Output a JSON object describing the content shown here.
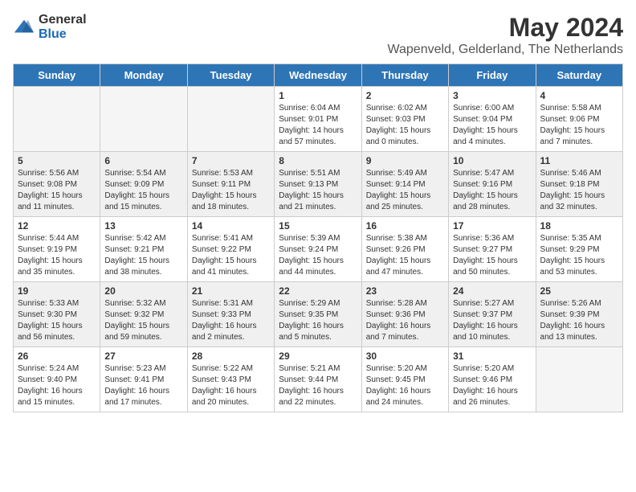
{
  "logo": {
    "general": "General",
    "blue": "Blue",
    "icon_color": "#2e75b6"
  },
  "title": "May 2024",
  "subtitle": "Wapenveld, Gelderland, The Netherlands",
  "days_of_week": [
    "Sunday",
    "Monday",
    "Tuesday",
    "Wednesday",
    "Thursday",
    "Friday",
    "Saturday"
  ],
  "weeks": [
    [
      {
        "num": "",
        "empty": true
      },
      {
        "num": "",
        "empty": true
      },
      {
        "num": "",
        "empty": true
      },
      {
        "num": "1",
        "sunrise": "Sunrise: 6:04 AM",
        "sunset": "Sunset: 9:01 PM",
        "daylight": "Daylight: 14 hours and 57 minutes."
      },
      {
        "num": "2",
        "sunrise": "Sunrise: 6:02 AM",
        "sunset": "Sunset: 9:03 PM",
        "daylight": "Daylight: 15 hours and 0 minutes."
      },
      {
        "num": "3",
        "sunrise": "Sunrise: 6:00 AM",
        "sunset": "Sunset: 9:04 PM",
        "daylight": "Daylight: 15 hours and 4 minutes."
      },
      {
        "num": "4",
        "sunrise": "Sunrise: 5:58 AM",
        "sunset": "Sunset: 9:06 PM",
        "daylight": "Daylight: 15 hours and 7 minutes."
      }
    ],
    [
      {
        "num": "5",
        "sunrise": "Sunrise: 5:56 AM",
        "sunset": "Sunset: 9:08 PM",
        "daylight": "Daylight: 15 hours and 11 minutes."
      },
      {
        "num": "6",
        "sunrise": "Sunrise: 5:54 AM",
        "sunset": "Sunset: 9:09 PM",
        "daylight": "Daylight: 15 hours and 15 minutes."
      },
      {
        "num": "7",
        "sunrise": "Sunrise: 5:53 AM",
        "sunset": "Sunset: 9:11 PM",
        "daylight": "Daylight: 15 hours and 18 minutes."
      },
      {
        "num": "8",
        "sunrise": "Sunrise: 5:51 AM",
        "sunset": "Sunset: 9:13 PM",
        "daylight": "Daylight: 15 hours and 21 minutes."
      },
      {
        "num": "9",
        "sunrise": "Sunrise: 5:49 AM",
        "sunset": "Sunset: 9:14 PM",
        "daylight": "Daylight: 15 hours and 25 minutes."
      },
      {
        "num": "10",
        "sunrise": "Sunrise: 5:47 AM",
        "sunset": "Sunset: 9:16 PM",
        "daylight": "Daylight: 15 hours and 28 minutes."
      },
      {
        "num": "11",
        "sunrise": "Sunrise: 5:46 AM",
        "sunset": "Sunset: 9:18 PM",
        "daylight": "Daylight: 15 hours and 32 minutes."
      }
    ],
    [
      {
        "num": "12",
        "sunrise": "Sunrise: 5:44 AM",
        "sunset": "Sunset: 9:19 PM",
        "daylight": "Daylight: 15 hours and 35 minutes."
      },
      {
        "num": "13",
        "sunrise": "Sunrise: 5:42 AM",
        "sunset": "Sunset: 9:21 PM",
        "daylight": "Daylight: 15 hours and 38 minutes."
      },
      {
        "num": "14",
        "sunrise": "Sunrise: 5:41 AM",
        "sunset": "Sunset: 9:22 PM",
        "daylight": "Daylight: 15 hours and 41 minutes."
      },
      {
        "num": "15",
        "sunrise": "Sunrise: 5:39 AM",
        "sunset": "Sunset: 9:24 PM",
        "daylight": "Daylight: 15 hours and 44 minutes."
      },
      {
        "num": "16",
        "sunrise": "Sunrise: 5:38 AM",
        "sunset": "Sunset: 9:26 PM",
        "daylight": "Daylight: 15 hours and 47 minutes."
      },
      {
        "num": "17",
        "sunrise": "Sunrise: 5:36 AM",
        "sunset": "Sunset: 9:27 PM",
        "daylight": "Daylight: 15 hours and 50 minutes."
      },
      {
        "num": "18",
        "sunrise": "Sunrise: 5:35 AM",
        "sunset": "Sunset: 9:29 PM",
        "daylight": "Daylight: 15 hours and 53 minutes."
      }
    ],
    [
      {
        "num": "19",
        "sunrise": "Sunrise: 5:33 AM",
        "sunset": "Sunset: 9:30 PM",
        "daylight": "Daylight: 15 hours and 56 minutes."
      },
      {
        "num": "20",
        "sunrise": "Sunrise: 5:32 AM",
        "sunset": "Sunset: 9:32 PM",
        "daylight": "Daylight: 15 hours and 59 minutes."
      },
      {
        "num": "21",
        "sunrise": "Sunrise: 5:31 AM",
        "sunset": "Sunset: 9:33 PM",
        "daylight": "Daylight: 16 hours and 2 minutes."
      },
      {
        "num": "22",
        "sunrise": "Sunrise: 5:29 AM",
        "sunset": "Sunset: 9:35 PM",
        "daylight": "Daylight: 16 hours and 5 minutes."
      },
      {
        "num": "23",
        "sunrise": "Sunrise: 5:28 AM",
        "sunset": "Sunset: 9:36 PM",
        "daylight": "Daylight: 16 hours and 7 minutes."
      },
      {
        "num": "24",
        "sunrise": "Sunrise: 5:27 AM",
        "sunset": "Sunset: 9:37 PM",
        "daylight": "Daylight: 16 hours and 10 minutes."
      },
      {
        "num": "25",
        "sunrise": "Sunrise: 5:26 AM",
        "sunset": "Sunset: 9:39 PM",
        "daylight": "Daylight: 16 hours and 13 minutes."
      }
    ],
    [
      {
        "num": "26",
        "sunrise": "Sunrise: 5:24 AM",
        "sunset": "Sunset: 9:40 PM",
        "daylight": "Daylight: 16 hours and 15 minutes."
      },
      {
        "num": "27",
        "sunrise": "Sunrise: 5:23 AM",
        "sunset": "Sunset: 9:41 PM",
        "daylight": "Daylight: 16 hours and 17 minutes."
      },
      {
        "num": "28",
        "sunrise": "Sunrise: 5:22 AM",
        "sunset": "Sunset: 9:43 PM",
        "daylight": "Daylight: 16 hours and 20 minutes."
      },
      {
        "num": "29",
        "sunrise": "Sunrise: 5:21 AM",
        "sunset": "Sunset: 9:44 PM",
        "daylight": "Daylight: 16 hours and 22 minutes."
      },
      {
        "num": "30",
        "sunrise": "Sunrise: 5:20 AM",
        "sunset": "Sunset: 9:45 PM",
        "daylight": "Daylight: 16 hours and 24 minutes."
      },
      {
        "num": "31",
        "sunrise": "Sunrise: 5:20 AM",
        "sunset": "Sunset: 9:46 PM",
        "daylight": "Daylight: 16 hours and 26 minutes."
      },
      {
        "num": "",
        "empty": true
      }
    ]
  ]
}
